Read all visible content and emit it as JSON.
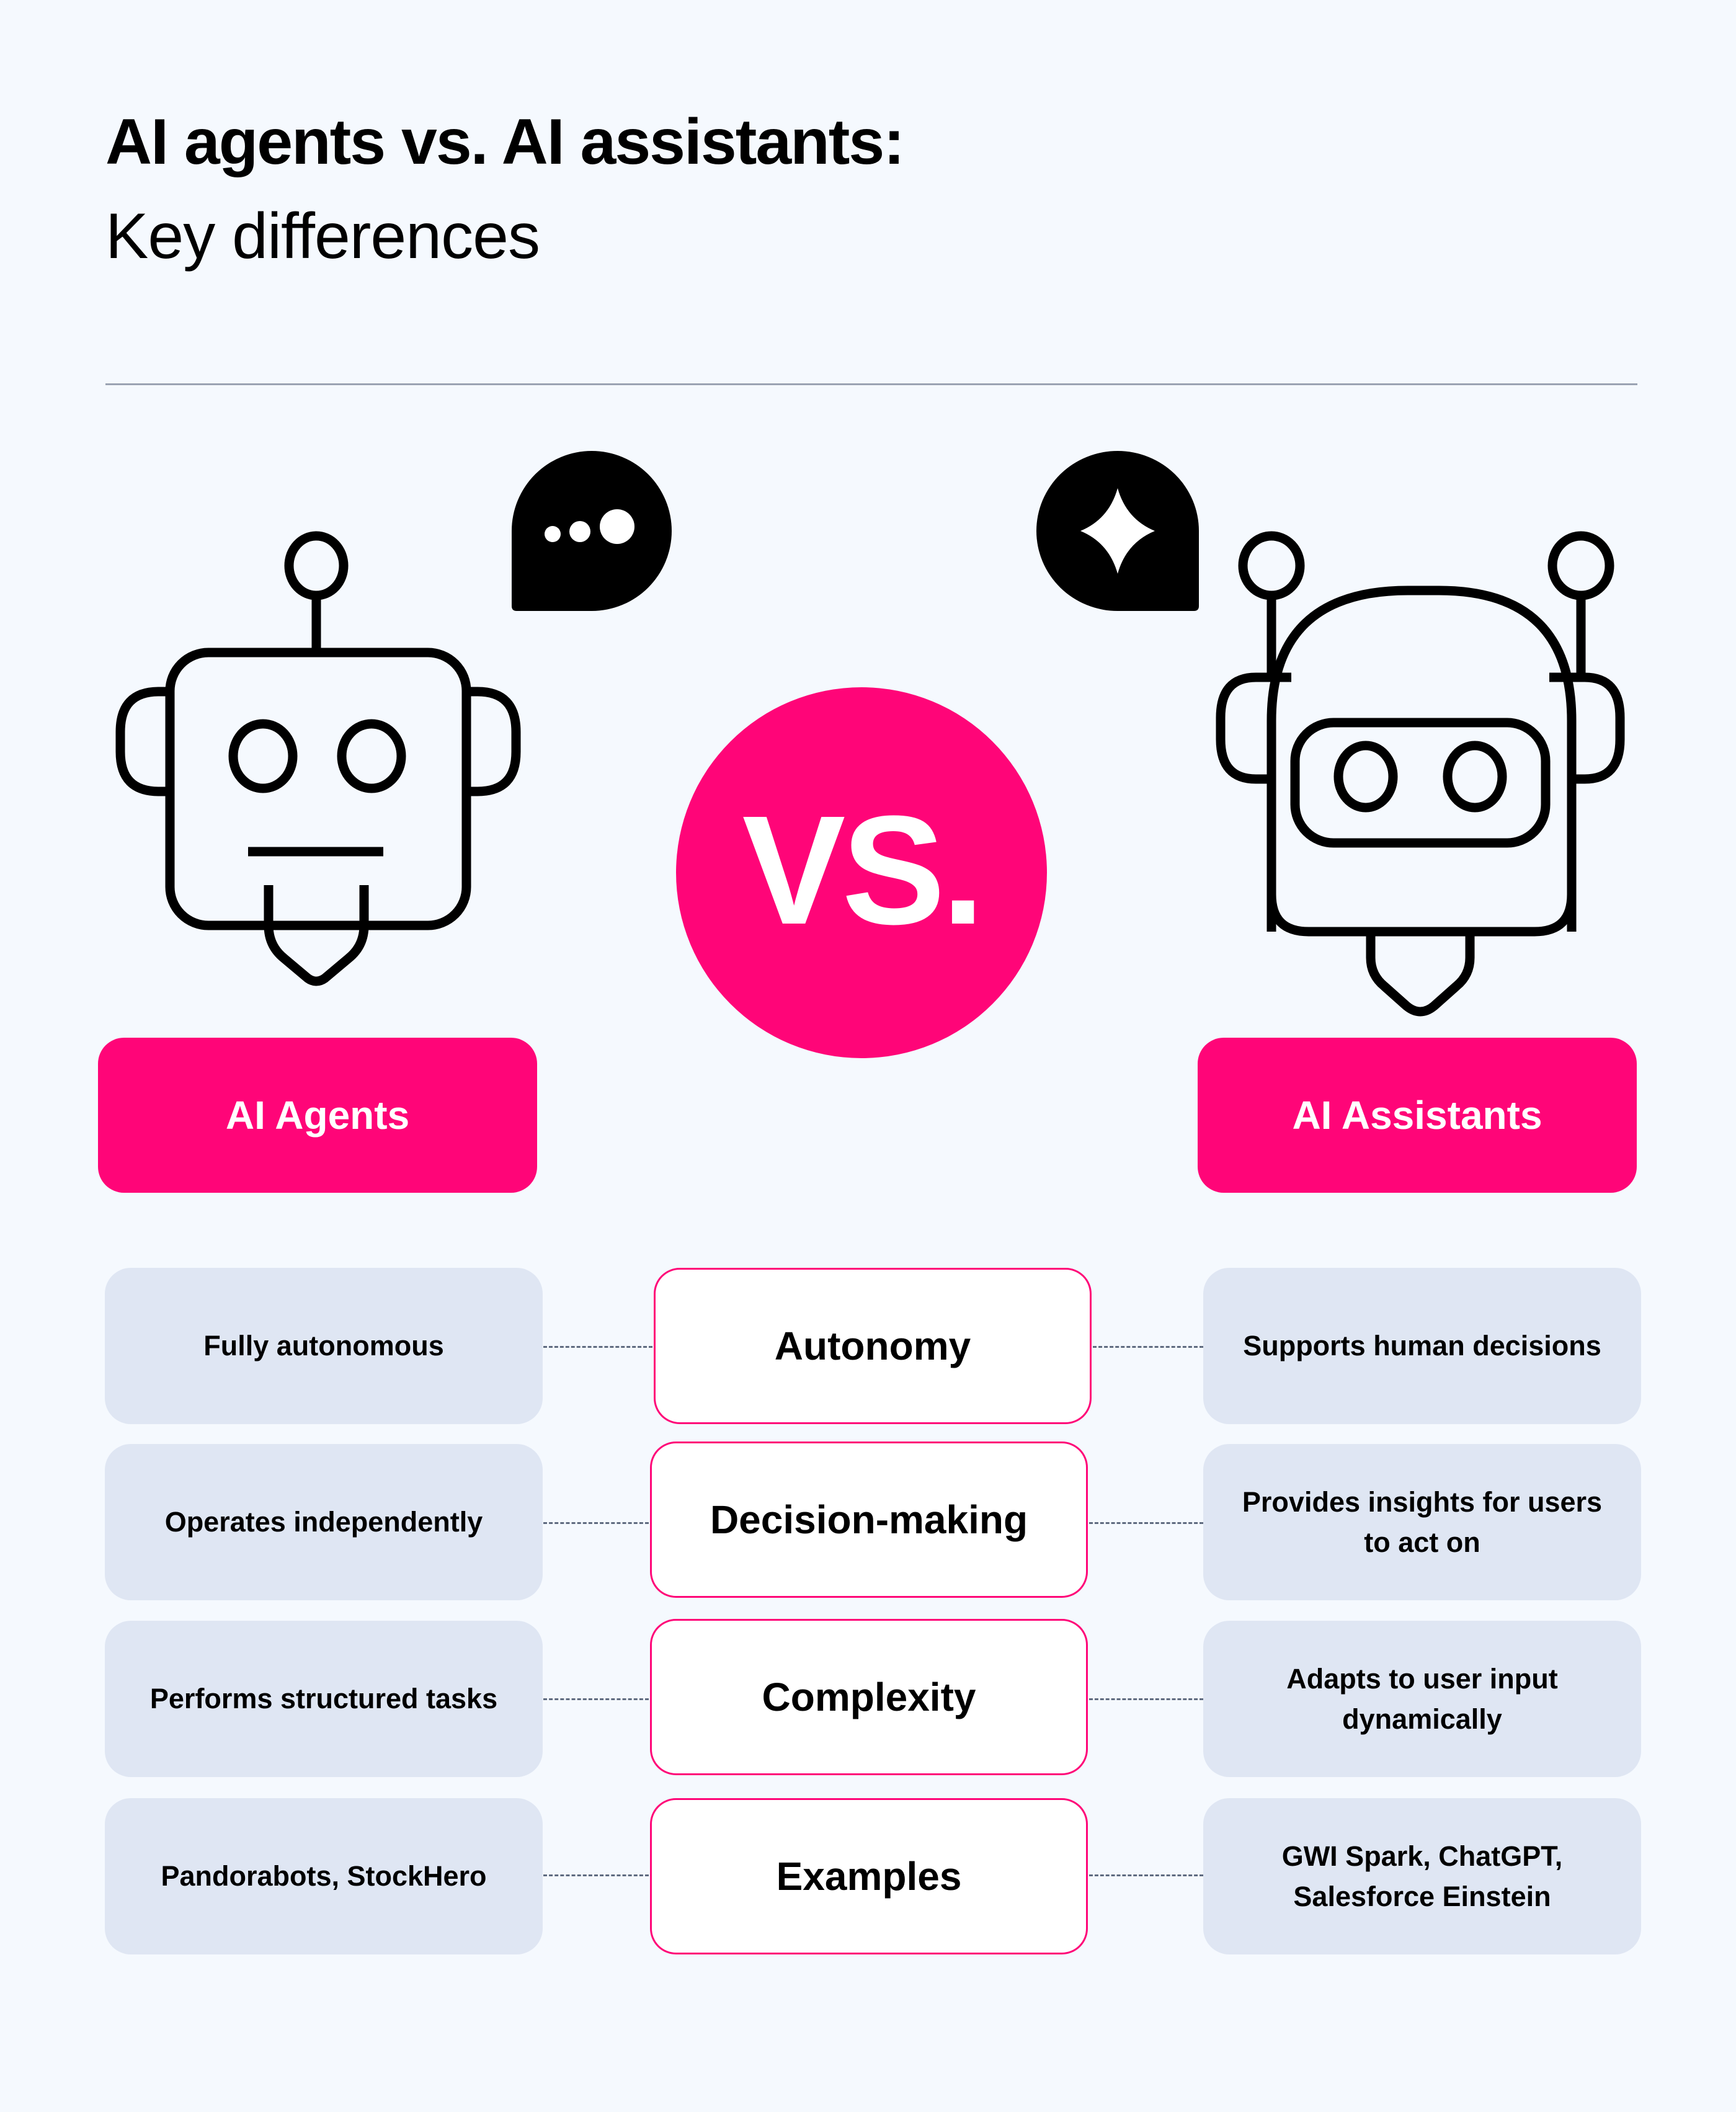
{
  "header": {
    "title": "AI agents vs. AI assistants:",
    "subtitle": "Key differences"
  },
  "colors": {
    "accent": "#ff0578",
    "background": "#f5f9fe",
    "cell_background": "#dfe6f3",
    "connector": "#5f6b80"
  },
  "icons": {
    "left_bubble": "speech-bubble-typing-dots-icon",
    "right_bubble": "speech-bubble-sparkle-icon",
    "left_robot": "square-robot-icon",
    "right_robot": "helmet-robot-icon"
  },
  "vs_label": "VS.",
  "columns": {
    "left": "AI Agents",
    "right": "AI Assistants"
  },
  "rows": [
    {
      "criterion": "Autonomy",
      "agents": "Fully autonomous",
      "assistants": "Supports human decisions"
    },
    {
      "criterion": "Decision-making",
      "agents": "Operates independently",
      "assistants": "Provides insights for users to act on"
    },
    {
      "criterion": "Complexity",
      "agents": "Performs structured tasks",
      "assistants": "Adapts to user input dynamically"
    },
    {
      "criterion": "Examples",
      "agents": "Pandorabots, StockHero",
      "assistants": "GWI Spark, ChatGPT, Salesforce Einstein"
    }
  ]
}
